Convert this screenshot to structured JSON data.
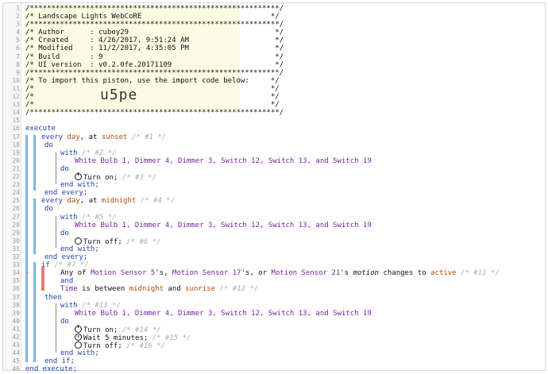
{
  "header": {
    "border": "/**********************************************************/",
    "title": "/* Landscape Lights WebCoRE                              */",
    "author": "/* Author      : cuboy29                                  */",
    "created": "/* Created     : 4/26/2017, 9:51:24 AM                    */",
    "modified": "/* Modified    : 11/2/2017, 4:35:05 PM                    */",
    "build": "/* Build       : 9                                        */",
    "ui_version": "/* UI version  : v0.2.0fe.20171109                        */",
    "import_text": "/* To import this piston, use the import code below:     */",
    "blank1": "/*                                                       */",
    "blank2": "/*                                                       */",
    "blank3": "/*                                                       */",
    "import_code": "u5pe"
  },
  "tokens": {
    "execute": "execute",
    "every": "every",
    "day": "day",
    "at": ", at",
    "sunset": "sunset",
    "midnight": "midnight",
    "do": "do",
    "with": "with",
    "end_with": "end with;",
    "end_every": "end every;",
    "if": "if",
    "and": "and",
    "then": "then",
    "end_if": "end if;",
    "end_execute": "end execute;",
    "devices": "White Bulb 1, Dimmer 4, Dimmer 3, Switch 12, Switch 13, and Switch 19",
    "turn_on": "Turn on;",
    "turn_off": "Turn off;",
    "wait": "Wait 5 minutes;"
  },
  "comments": {
    "c1": "/* #1 */",
    "c2": "/* #2 */",
    "c3": "/* #3 */",
    "c4": "/* #4 */",
    "c5": "/* #5 */",
    "c6": "/* #6 */",
    "c7": "/* #7 */",
    "c11": "/* #11 */",
    "c12": "/* #12 */",
    "c13": "/* #13 */",
    "c14": "/* #14 */",
    "c15": "/* #15 */",
    "c16": "/* #16 */"
  },
  "condition": {
    "prefix": "Any of ",
    "ms5": "Motion Sensor 5",
    "s1": "'s, ",
    "ms17": "Motion Sensor 17",
    "s2": "'s, or ",
    "ms21": "Motion Sensor 21",
    "s3": "'s ",
    "attr": "motion",
    "s4": " changes to ",
    "active": "active",
    "time": "Time",
    "between": " is between ",
    "midnight": "midnight",
    "and": " and ",
    "sunrise": "sunrise"
  },
  "colors": {
    "keyword": "#1c3fb0",
    "device": "#7a1fa8",
    "variable": "#b84a00",
    "block_bar": "#7fb7e6",
    "condition_bar": "#e87a6f"
  },
  "line_numbers": [
    "1",
    "2",
    "3",
    "4",
    "5",
    "6",
    "7",
    "8",
    "9",
    "10",
    "11",
    "12",
    "13",
    "14",
    "15",
    "16",
    "17",
    "18",
    "19",
    "20",
    "21",
    "22",
    "23",
    "24",
    "25",
    "26",
    "27",
    "28",
    "29",
    "30",
    "31",
    "32",
    "33",
    "34",
    "35",
    "36",
    "37",
    "38",
    "39",
    "40",
    "41",
    "42",
    "43",
    "44",
    "45",
    "46"
  ]
}
